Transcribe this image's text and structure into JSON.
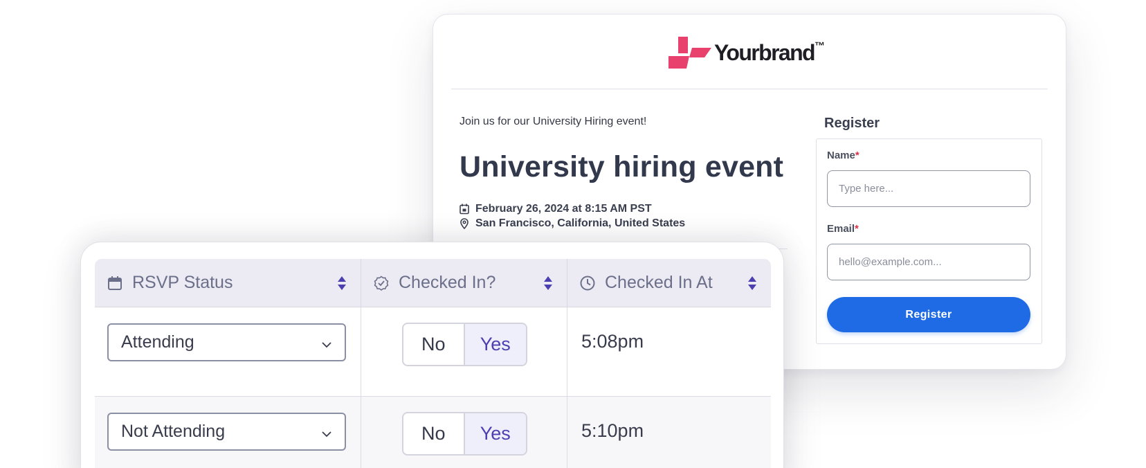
{
  "brand": {
    "name": "Yourbrand",
    "trademark": "™",
    "color": "#e8416e"
  },
  "event": {
    "intro": "Join us for our University Hiring event!",
    "title": "University hiring event",
    "date": "February 26, 2024 at 8:15 AM PST",
    "location": "San Francisco, California, United States"
  },
  "register": {
    "heading": "Register",
    "name_label": "Name",
    "name_placeholder": "Type here...",
    "email_label": "Email",
    "email_placeholder": "hello@example.com...",
    "required_mark": "*",
    "button_label": "Register",
    "button_color": "#1f6be6"
  },
  "table": {
    "columns": [
      {
        "label": "RSVP Status",
        "icon": "calendar-icon"
      },
      {
        "label": "Checked In?",
        "icon": "check-badge-icon"
      },
      {
        "label": "Checked In At",
        "icon": "clock-icon"
      }
    ],
    "rows": [
      {
        "rsvp": "Attending",
        "no_label": "No",
        "yes_label": "Yes",
        "selected": "Yes",
        "time": "5:08pm"
      },
      {
        "rsvp": "Not Attending",
        "no_label": "No",
        "yes_label": "Yes",
        "selected": "Yes",
        "time": "5:10pm"
      }
    ],
    "accent_color": "#4c3fb0"
  }
}
